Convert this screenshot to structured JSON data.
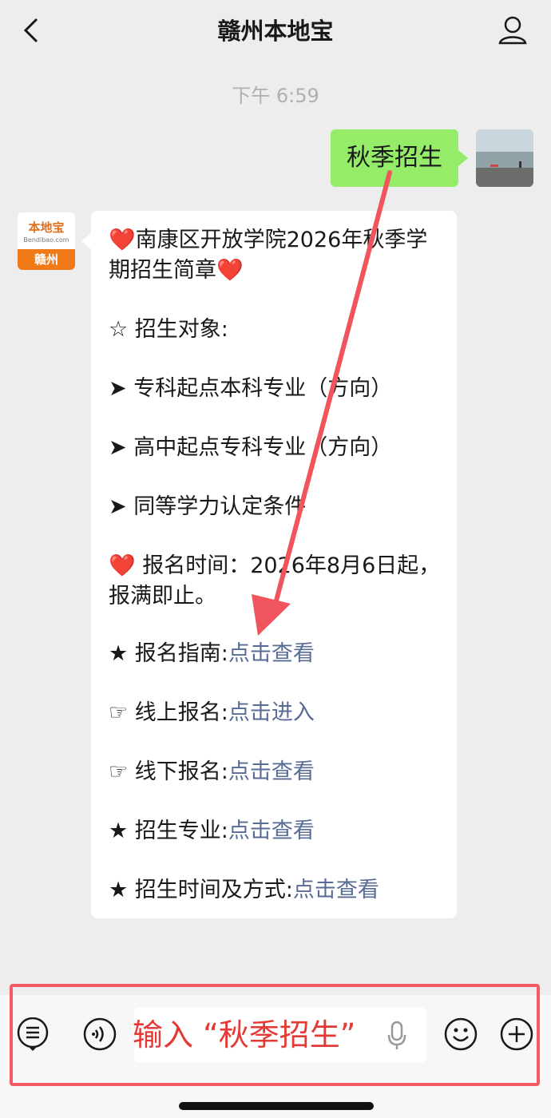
{
  "header": {
    "title": "赣州本地宝",
    "back_icon": "chevron-left-icon",
    "profile_icon": "person-icon"
  },
  "timestamp": "下午 6:59",
  "sent_message": {
    "text": "秋季招生"
  },
  "bot_avatar": {
    "brand": "本地宝",
    "site": "Bendibao.com",
    "city": "赣州"
  },
  "reply": {
    "heart": "❤️",
    "title_text": "南康区开放学院2026年秋季学期招生简章",
    "target_label": "☆ 招生对象:",
    "items": [
      "➤ 专科起点本科专业（方向）",
      "➤ 高中起点专科专业（方向）",
      "➤ 同等学力认定条件"
    ],
    "signup_time": " 报名时间：2026年8月6日起，报满即止。",
    "links": [
      {
        "prefix": "★ 报名指南:",
        "link": "点击查看"
      },
      {
        "prefix": "☞ 线上报名:",
        "link": "点击进入"
      },
      {
        "prefix": "☞ 线下报名:",
        "link": "点击查看"
      },
      {
        "prefix": "★ 招生专业:",
        "link": "点击查看"
      },
      {
        "prefix": "★ 招生时间及方式:",
        "link": "点击查看"
      }
    ]
  },
  "input_bar": {
    "hint_text": "输入 “秋季招生”",
    "icons": [
      "menu-icon",
      "voice-icon",
      "mic-icon",
      "emoji-icon",
      "plus-icon"
    ]
  },
  "colors": {
    "accent_red": "#e53935",
    "link": "#576b95",
    "bubble_green": "#95ec69"
  }
}
